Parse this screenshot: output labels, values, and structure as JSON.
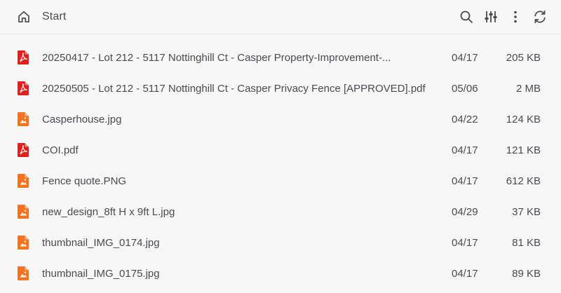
{
  "header": {
    "breadcrumb": "Start",
    "icons": [
      "home-icon",
      "search-icon",
      "filter-icon",
      "more-vertical-icon",
      "refresh-icon"
    ]
  },
  "colors": {
    "pdf": "#e0201d",
    "image": "#f5731f",
    "text": "#4a4a4f",
    "background": "#f7f7f8"
  },
  "files": [
    {
      "name": "20250417 - Lot 212 - 5117 Nottinghill Ct - Casper Property-Improvement-...",
      "date": "04/17",
      "size": "205 KB",
      "type": "pdf"
    },
    {
      "name": "20250505 - Lot 212 - 5117 Nottinghill Ct - Casper Privacy Fence [APPROVED].pdf",
      "date": "05/06",
      "size": "2 MB",
      "type": "pdf"
    },
    {
      "name": "Casperhouse.jpg",
      "date": "04/22",
      "size": "124 KB",
      "type": "image"
    },
    {
      "name": "COI.pdf",
      "date": "04/17",
      "size": "121 KB",
      "type": "pdf"
    },
    {
      "name": "Fence quote.PNG",
      "date": "04/17",
      "size": "612 KB",
      "type": "image"
    },
    {
      "name": "new_design_8ft H x 9ft L.jpg",
      "date": "04/29",
      "size": "37 KB",
      "type": "image"
    },
    {
      "name": "thumbnail_IMG_0174.jpg",
      "date": "04/17",
      "size": "81 KB",
      "type": "image"
    },
    {
      "name": "thumbnail_IMG_0175.jpg",
      "date": "04/17",
      "size": "89 KB",
      "type": "image"
    }
  ]
}
